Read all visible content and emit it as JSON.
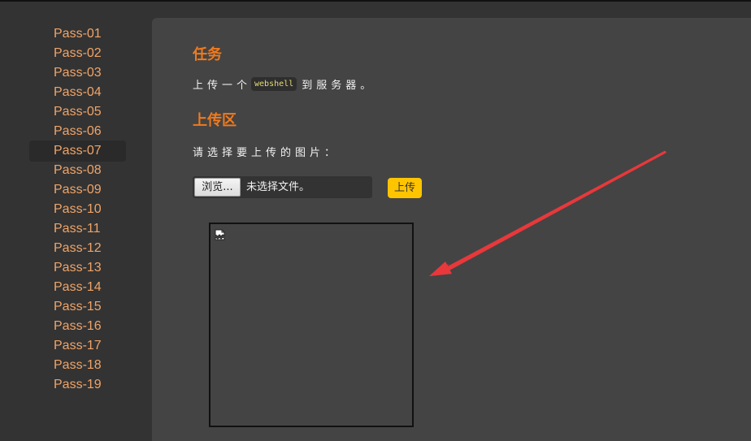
{
  "sidebar": {
    "items": [
      {
        "label": "Pass-01"
      },
      {
        "label": "Pass-02"
      },
      {
        "label": "Pass-03"
      },
      {
        "label": "Pass-04"
      },
      {
        "label": "Pass-05"
      },
      {
        "label": "Pass-06"
      },
      {
        "label": "Pass-07",
        "active": true
      },
      {
        "label": "Pass-08"
      },
      {
        "label": "Pass-09"
      },
      {
        "label": "Pass-10"
      },
      {
        "label": "Pass-11"
      },
      {
        "label": "Pass-12"
      },
      {
        "label": "Pass-13"
      },
      {
        "label": "Pass-14"
      },
      {
        "label": "Pass-15"
      },
      {
        "label": "Pass-16"
      },
      {
        "label": "Pass-17"
      },
      {
        "label": "Pass-18"
      },
      {
        "label": "Pass-19"
      }
    ]
  },
  "task": {
    "heading": "任务",
    "text_before": "上传一个",
    "code": "webshell",
    "text_after": "到服务器。"
  },
  "upload": {
    "heading": "上传区",
    "choose_label": "请选择要上传的图片：",
    "browse_label": "浏览...",
    "no_file_text": "未选择文件。",
    "submit_label": "上传"
  },
  "preview": {
    "icon": "broken-image-icon"
  },
  "annotation": {
    "icon": "red-arrow",
    "color": "#e8383b"
  },
  "colors": {
    "accent": "#f07a1e",
    "sidebar_link": "#f0a468",
    "upload_button": "#ffc400",
    "code_text": "#e6db74"
  }
}
